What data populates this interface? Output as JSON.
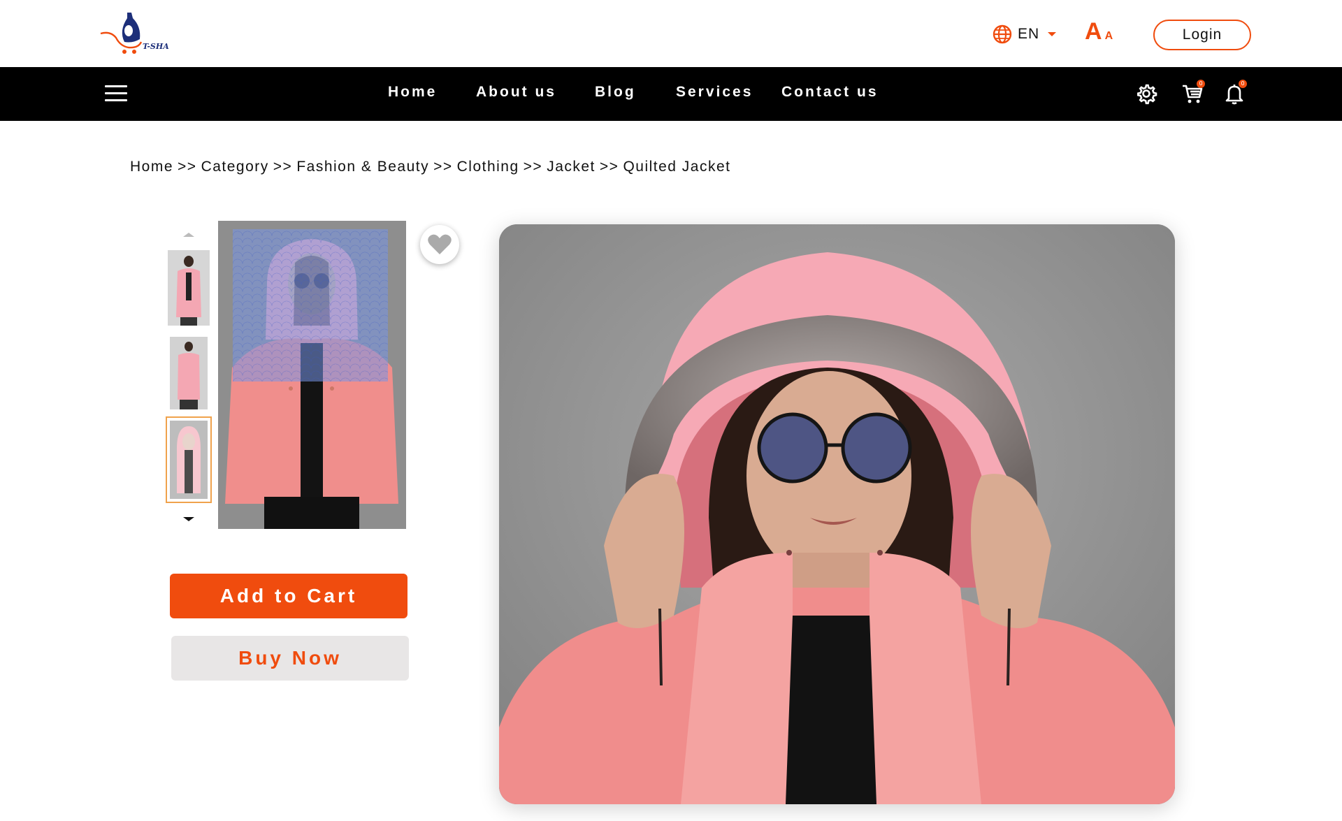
{
  "brand": {
    "logo_text": "T-SHA",
    "colors": {
      "accent": "#F04C0E",
      "logo_blue": "#1d2f7a",
      "navbar": "#000000"
    }
  },
  "topbar": {
    "language": {
      "icon": "globe-icon",
      "label": "EN"
    },
    "font_size": {
      "big": "A",
      "small": "A"
    },
    "login_label": "Login"
  },
  "nav": {
    "items": [
      {
        "label": "Home"
      },
      {
        "label": "About us"
      },
      {
        "label": "Blog"
      },
      {
        "label": "Services"
      },
      {
        "label": "Contact us"
      }
    ],
    "icons": [
      {
        "name": "settings-icon"
      },
      {
        "name": "cart-icon",
        "badge": "0"
      },
      {
        "name": "bell-icon",
        "badge": "0"
      }
    ]
  },
  "breadcrumb": {
    "separator": ">>",
    "items": [
      "Home",
      "Category",
      "Fashion & Beauty",
      "Clothing",
      "Jacket",
      "Quilted Jacket"
    ]
  },
  "gallery": {
    "thumbnails": [
      {
        "name": "thumbnail-front"
      },
      {
        "name": "thumbnail-side"
      },
      {
        "name": "thumbnail-hood",
        "selected": true
      }
    ]
  },
  "actions": {
    "add_to_cart": "Add to Cart",
    "buy_now": "Buy Now"
  }
}
